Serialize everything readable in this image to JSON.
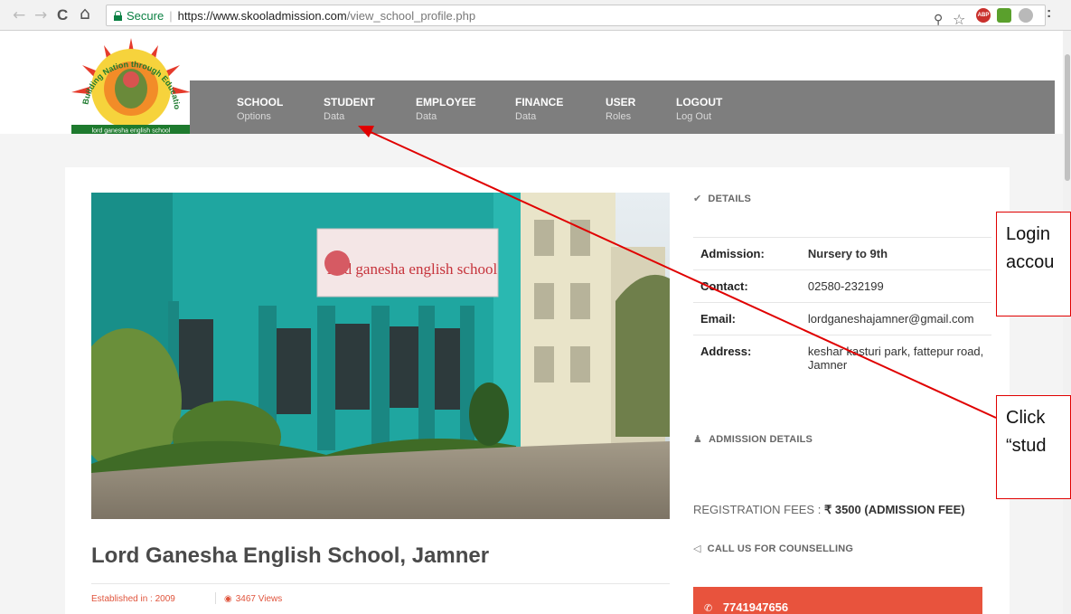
{
  "browser": {
    "back_glyph": "←",
    "forward_glyph": "→",
    "reload_glyph": "C",
    "home_glyph": "⌂",
    "secure_label": "Secure",
    "url_host": "https://www.skooladmission.com",
    "url_path": "/view_school_profile.php",
    "abp_label": "ABP",
    "menu_glyph": ":"
  },
  "logo": {
    "text_arc": "Building Nation through Education",
    "text_ribbon": "lord ganesha english school"
  },
  "nav": [
    {
      "main": "SCHOOL",
      "sub": "Options"
    },
    {
      "main": "STUDENT",
      "sub": "Data"
    },
    {
      "main": "EMPLOYEE",
      "sub": "Data"
    },
    {
      "main": "FINANCE",
      "sub": "Data"
    },
    {
      "main": "USER",
      "sub": "Roles"
    },
    {
      "main": "LOGOUT",
      "sub": "Log Out"
    }
  ],
  "school": {
    "name": "Lord Ganesha English School, Jamner",
    "established": "Established in : 2009",
    "views": "3467 Views",
    "sign_text": "lord ganesha english school"
  },
  "details": {
    "heading": "DETAILS",
    "rows": [
      {
        "key": "Admission:",
        "value": "Nursery to 9th"
      },
      {
        "key": "Contact:",
        "value": "02580-232199"
      },
      {
        "key": "Email:",
        "value": "lordganeshajamner@gmail.com"
      },
      {
        "key": "Address:",
        "value": "keshar kasturi park, fattepur road, Jamner"
      }
    ]
  },
  "admission": {
    "heading": "ADMISSION DETAILS",
    "fees_label": "REGISTRATION FEES : ",
    "fees_value": "₹ 3500 (ADMISSION FEE)"
  },
  "counselling": {
    "heading": "CALL US FOR COUNSELLING",
    "phone": "7741947656"
  },
  "callouts": {
    "login_line1": "Login",
    "login_line2": "accou",
    "click_line1": "Click",
    "click_line2": "“stud"
  },
  "colors": {
    "navbar": "#7e7e7e",
    "accent_red": "#e8533d",
    "annotation_red": "#e00000",
    "secure_green": "#0b8043"
  }
}
